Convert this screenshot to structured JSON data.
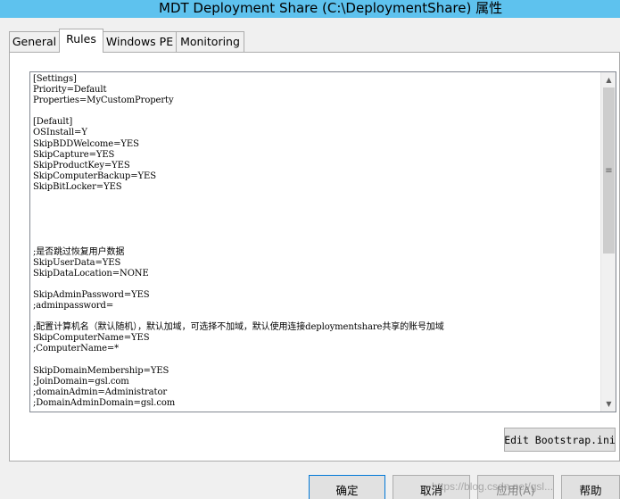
{
  "window": {
    "title": "MDT Deployment Share (C:\\DeploymentShare) 属性"
  },
  "tabs": [
    {
      "label": "General"
    },
    {
      "label": "Rules"
    },
    {
      "label": "Windows PE"
    },
    {
      "label": "Monitoring"
    }
  ],
  "rules": {
    "text": "[Settings]\nPriority=Default\nProperties=MyCustomProperty\n\n[Default]\nOSInstall=Y\nSkipBDDWelcome=YES\nSkipCapture=YES\nSkipProductKey=YES\nSkipComputerBackup=YES\nSkipBitLocker=YES\n\n\n\n\n\n;是否跳过恢复用户数据\nSkipUserData=YES\nSkipDataLocation=NONE\n\nSkipAdminPassword=YES\n;adminpassword=\n\n;配置计算机名（默认随机），默认加域，可选择不加域，默认使用连接deploymentshare共享的账号加域\nSkipComputerName=YES\n;ComputerName=*\n\nSkipDomainMembership=YES\n;JoinDomain=gsl.com\n;domainAdmin=Administrator\n;DomainAdminDomain=gsl.com"
  },
  "buttons": {
    "edit_bootstrap": "Edit Bootstrap.ini",
    "ok": "确定",
    "cancel": "取消",
    "apply": "应用(A)",
    "help": "帮助"
  },
  "watermark": "https://blog.csdn.net/gsl..."
}
